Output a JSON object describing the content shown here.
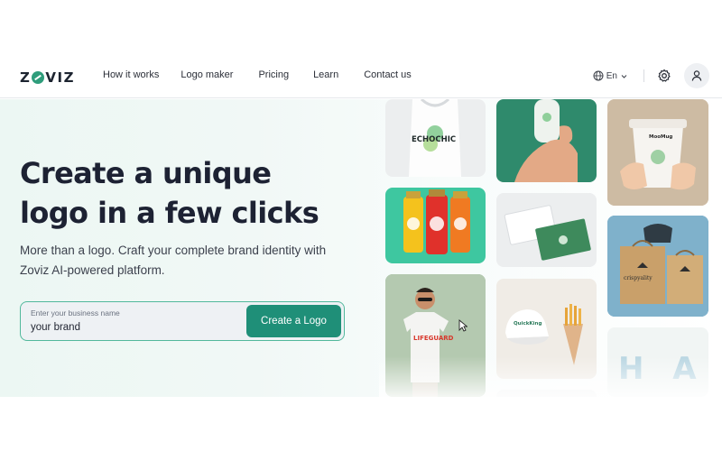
{
  "brand": {
    "name_left": "Z",
    "name_right": "VIZ"
  },
  "nav": {
    "links": [
      "How it works",
      "Logo maker",
      "Pricing",
      "Learn",
      "Contact us"
    ],
    "language": "En"
  },
  "hero": {
    "headline_line1": "Create a unique",
    "headline_line2": "logo in a few clicks",
    "subtitle": "More than a logo. Craft your complete brand identity with Zoviz AI-powered platform.",
    "input_label": "Enter your business name",
    "input_value": "your brand",
    "cta_label": "Create a Logo"
  },
  "gallery": {
    "tote_text": "ECHOCHIC",
    "cup_text": "MooMug",
    "bag_text": "crispyality",
    "tshirt_text": "LIFEGUARD",
    "cap_text": "QuickKing",
    "partial_text": "H A"
  },
  "colors": {
    "accent": "#1f8f78",
    "accent_light": "#52b89c",
    "text_dark": "#1d2233"
  }
}
